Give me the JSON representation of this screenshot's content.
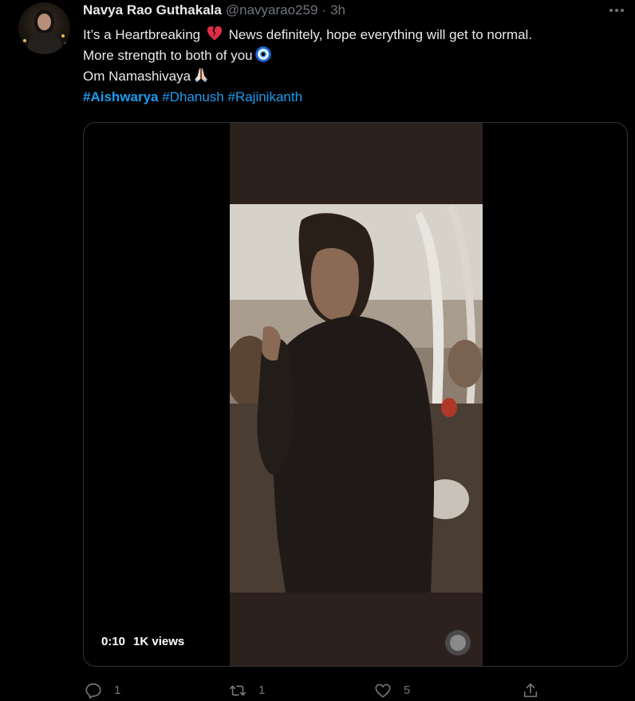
{
  "tweet": {
    "author_name": "Navya Rao Guthakala",
    "author_handle": "@navyarao259",
    "separator": "·",
    "time": "3h",
    "text": {
      "line1_before": "It’s a Heartbreaking",
      "line1_after": "News definitely, hope everything will get to normal.",
      "line2": "More strength to both of you",
      "line3": "Om Namashivaya",
      "hashtags": [
        "#Aishwarya",
        "#Dhanush",
        "#Rajinikanth"
      ]
    },
    "emojis": {
      "line1": "broken-heart-icon",
      "line2": "nazar-amulet-icon",
      "line3": "folded-hands-icon"
    },
    "video": {
      "duration": "0:10",
      "views": "1K views"
    },
    "actions": {
      "reply_count": "1",
      "retweet_count": "1",
      "like_count": "5",
      "share_count": ""
    }
  },
  "colors": {
    "background": "#000000",
    "text": "#e7e9ea",
    "secondary_text": "#71767b",
    "link": "#1d9bf0",
    "border": "#2f3336"
  }
}
